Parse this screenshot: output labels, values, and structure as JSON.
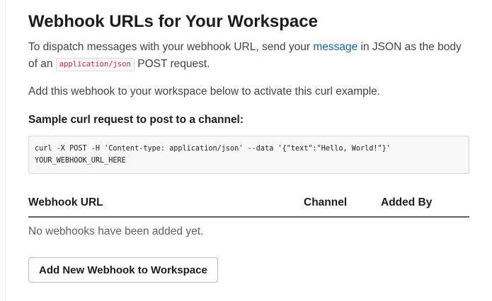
{
  "page": {
    "title": "Webhook URLs for Your Workspace",
    "intro": {
      "part1": "To dispatch messages with your webhook URL, send your ",
      "link": "message",
      "part2": " in JSON as the body of an ",
      "code": "application/json",
      "part3": " POST request."
    },
    "activate_text": "Add this webhook to your workspace below to activate this curl example.",
    "sample_heading": "Sample curl request to post to a channel:",
    "sample_code": "curl -X POST -H 'Content-type: application/json' --data '{\"text\":\"Hello, World!\"}'\nYOUR_WEBHOOK_URL_HERE"
  },
  "table": {
    "columns": {
      "url": "Webhook URL",
      "channel": "Channel",
      "added_by": "Added By"
    },
    "empty_message": "No webhooks have been added yet."
  },
  "actions": {
    "add_button": "Add New Webhook to Workspace"
  },
  "colors": {
    "link": "#1264a3",
    "inline_code": "#e01e5a",
    "text": "#1d1c1d",
    "muted_text": "#616061"
  }
}
